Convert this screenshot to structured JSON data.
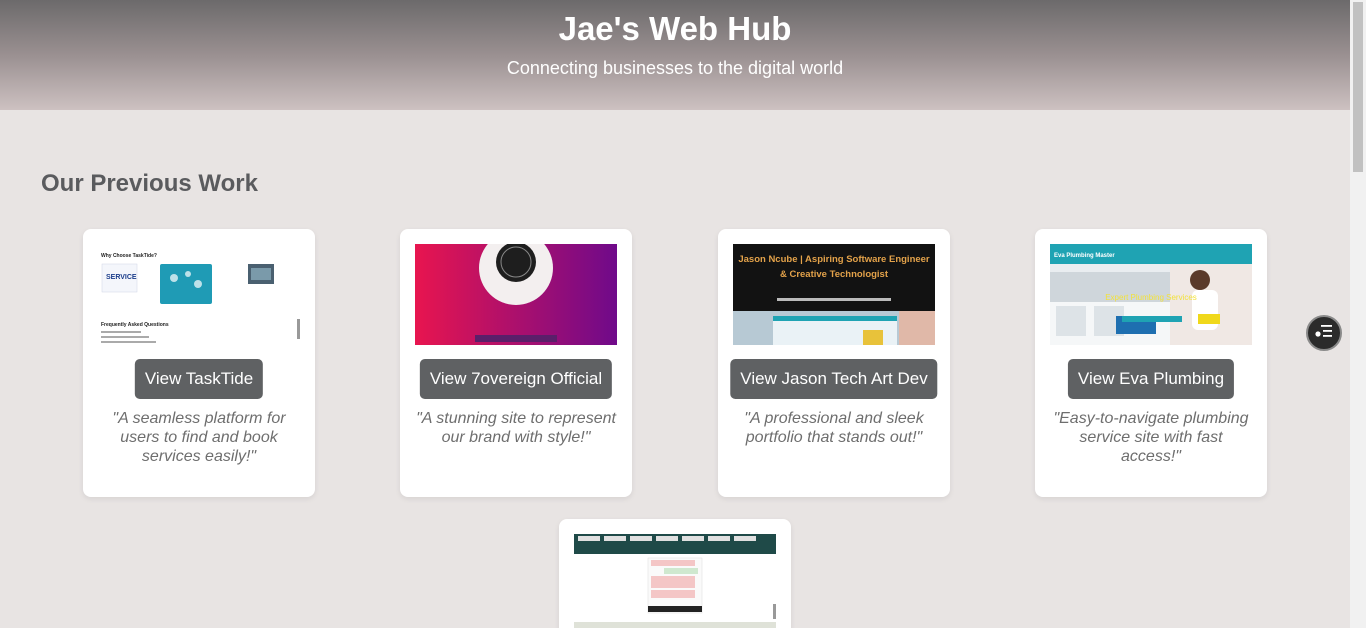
{
  "header": {
    "title": "Jae's Web Hub",
    "subtitle": "Connecting businesses to the digital world"
  },
  "main": {
    "section_title": "Our Previous Work",
    "cards": [
      {
        "button_label": "View TaskTide",
        "quote": "\"A seamless platform for users to find and book services easily!\"",
        "thumb_heading": "Why Choose TaskTide?",
        "thumb_subheading": "Frequently Asked Questions"
      },
      {
        "button_label": "View 7overeign Official",
        "quote": "\"A stunning site to represent our brand with style!\""
      },
      {
        "button_label": "View Jason Tech Art Dev",
        "quote": "\"A professional and sleek portfolio that stands out!\"",
        "thumb_heading": "Jason Ncube | Aspiring Software Engineer & Creative Technologist"
      },
      {
        "button_label": "View Eva Plumbing",
        "quote": "\"Easy-to-navigate plumbing service site with fast access!\"",
        "thumb_brand": "Eva Plumbing Master",
        "thumb_tagline": "Expert Plumbing Services"
      },
      {}
    ]
  },
  "icons": {
    "fab": "toc-list-icon"
  },
  "colors": {
    "button_bg": "#5f6163",
    "page_bg": "#e8e4e3",
    "eva_accent": "#1fa3b3",
    "sovereign_gradient_start": "#e8154f",
    "sovereign_gradient_end": "#6f0a8a"
  }
}
